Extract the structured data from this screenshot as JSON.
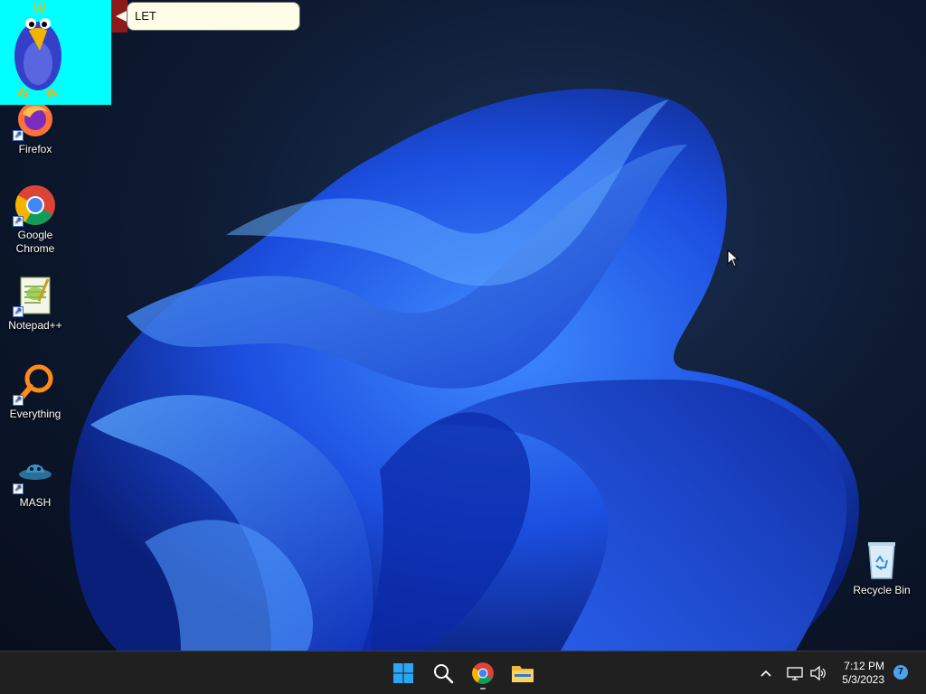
{
  "desktop": {
    "icons": [
      {
        "label": "Firefox",
        "icon": "firefox-icon"
      },
      {
        "label": "Google Chrome",
        "icon": "chrome-icon"
      },
      {
        "label": "Notepad++",
        "icon": "notepadpp-icon"
      },
      {
        "label": "Everything",
        "icon": "everything-icon"
      },
      {
        "label": "MASH",
        "icon": "mash-icon"
      },
      {
        "label": "Recycle Bin",
        "icon": "recycle-bin-icon"
      }
    ]
  },
  "agent": {
    "balloon_text": "LET",
    "character": "parrot-agent-icon"
  },
  "taskbar": {
    "pinned": [
      {
        "name": "start-button",
        "icon": "windows-logo-icon"
      },
      {
        "name": "search-button",
        "icon": "search-icon"
      },
      {
        "name": "chrome-taskbar-button",
        "icon": "chrome-icon"
      },
      {
        "name": "file-explorer-button",
        "icon": "folder-icon"
      }
    ],
    "tray": {
      "time": "7:12 PM",
      "date": "5/3/2023",
      "notification_count": "7"
    }
  },
  "colors": {
    "agent_background": "#00ffff",
    "taskbar": "#202020",
    "accent": "#4aa3f0"
  }
}
